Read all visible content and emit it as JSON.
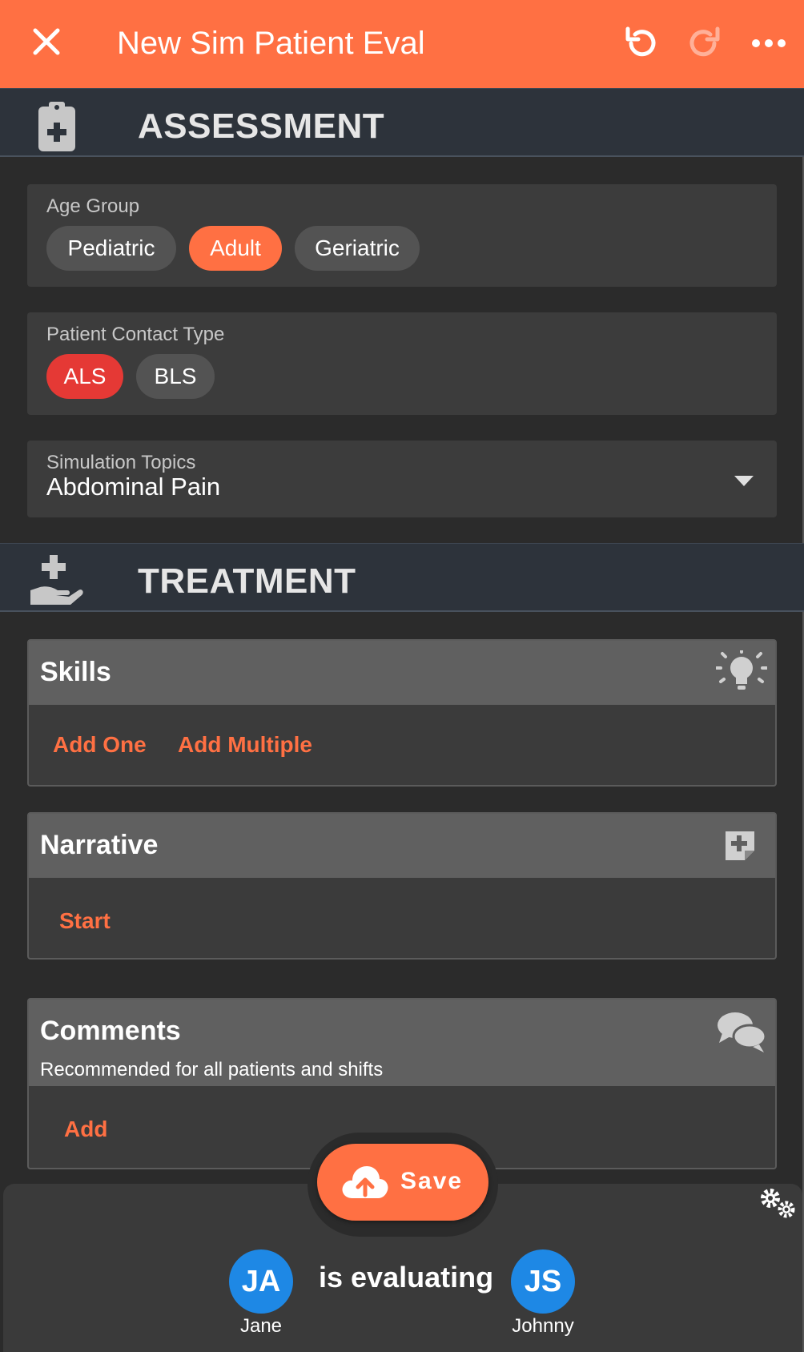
{
  "header": {
    "title": "New Sim Patient Eval",
    "close_icon": "close-icon",
    "undo_icon": "undo-icon",
    "redo_icon": "redo-icon",
    "more_icon": "more-horizontal-icon",
    "accent_color": "#ff7043"
  },
  "assessment": {
    "title": "ASSESSMENT",
    "icon": "clipboard-medical-icon",
    "age_group": {
      "label": "Age Group",
      "options": [
        "Pediatric",
        "Adult",
        "Geriatric"
      ],
      "selected": "Adult"
    },
    "contact_type": {
      "label": "Patient Contact Type",
      "options": [
        "ALS",
        "BLS"
      ],
      "selected": "ALS"
    },
    "sim_topics": {
      "label": "Simulation Topics",
      "value": "Abdominal Pain"
    }
  },
  "treatment": {
    "title": "TREATMENT",
    "icon": "hand-medical-icon",
    "skills": {
      "title": "Skills",
      "icon": "lightbulb-icon",
      "add_one": "Add One",
      "add_multiple": "Add Multiple"
    },
    "narrative": {
      "title": "Narrative",
      "icon": "add-note-icon",
      "start": "Start"
    },
    "comments": {
      "title": "Comments",
      "subtitle": "Recommended for all patients and shifts",
      "icon": "comments-icon",
      "add": "Add"
    }
  },
  "footer": {
    "save_label": "Save",
    "save_icon": "cloud-upload-icon",
    "settings_icon": "gears-icon",
    "evaluating_text": "is evaluating",
    "evaluator": {
      "initials": "JA",
      "name": "Jane"
    },
    "evaluatee": {
      "initials": "JS",
      "name": "Johnny"
    },
    "avatar_color": "#1e88e5"
  }
}
